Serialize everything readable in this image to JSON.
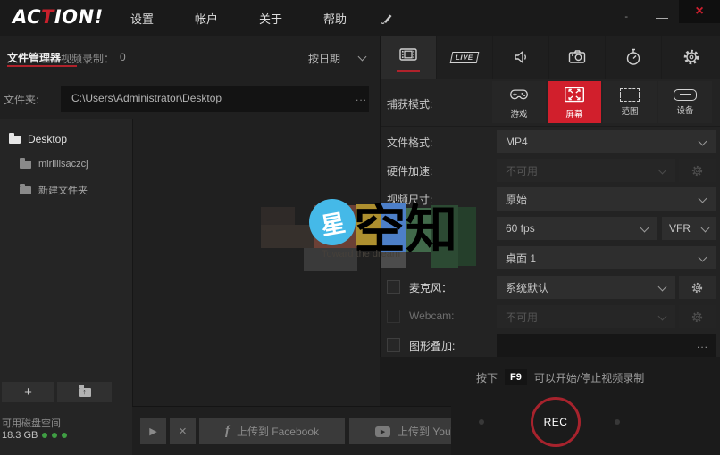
{
  "topbar": {
    "logo_pre": "AC",
    "logo_accent": "T",
    "logo_post": "ION!",
    "menu": [
      {
        "label": "设置"
      },
      {
        "label": "帐户"
      },
      {
        "label": "关于"
      },
      {
        "label": "帮助"
      }
    ],
    "tray": "-",
    "minimize": "—",
    "close": "×"
  },
  "file_manager": {
    "title": "文件管理器",
    "recordings_label": "视频录制：",
    "recordings_count": "0",
    "sort_label": "按日期",
    "folder_label": "文件夹:",
    "folder_path": "C:\\Users\\Administrator\\Desktop",
    "browse": "...",
    "tree": [
      {
        "label": "Desktop"
      },
      {
        "label": "mirillisaczcj"
      },
      {
        "label": "新建文件夹"
      }
    ],
    "add_button": "+",
    "upload_arrow": "↑",
    "disk_label": "可用磁盘空间",
    "disk_value": "18.3 GB",
    "play_glyph": "▶",
    "delete_glyph": "×",
    "facebook_glyph": "f",
    "youtube_glyph": "▶",
    "upload_facebook": "上传到 Facebook",
    "upload_youtube": "上传到 YouT"
  },
  "settings": {
    "live_badge": "LIVE",
    "capture_label": "捕获模式:",
    "modes": [
      {
        "label": "游戏"
      },
      {
        "label": "屏幕"
      },
      {
        "label": "范围"
      },
      {
        "label": "设备"
      }
    ],
    "rows": {
      "format": {
        "label": "文件格式:",
        "value": "MP4"
      },
      "hw": {
        "label": "硬件加速:",
        "value": "不可用"
      },
      "size": {
        "label": "视频尺寸:",
        "value": "原始"
      },
      "fps": {
        "value": "60 fps",
        "mode": "VFR"
      },
      "display": {
        "value": "桌面 1"
      },
      "mic": {
        "label": "麦克风：",
        "value": "系统默认"
      },
      "webcam": {
        "label": "Webcam:",
        "value": "不可用"
      },
      "overlay": {
        "label": "图形叠加:",
        "browse": "..."
      }
    },
    "hotkey": {
      "prefix": "按下",
      "key": "F9",
      "suffix": "可以开始/停止视频录制"
    },
    "rec_label": "REC"
  },
  "watermark": {
    "star": "星",
    "brand": "空知",
    "tagline": "Toward the dream"
  },
  "colors": {
    "accent": "#d11f2c",
    "rec_ring": "#a7232d",
    "disk_dots": "#3f9e43"
  }
}
